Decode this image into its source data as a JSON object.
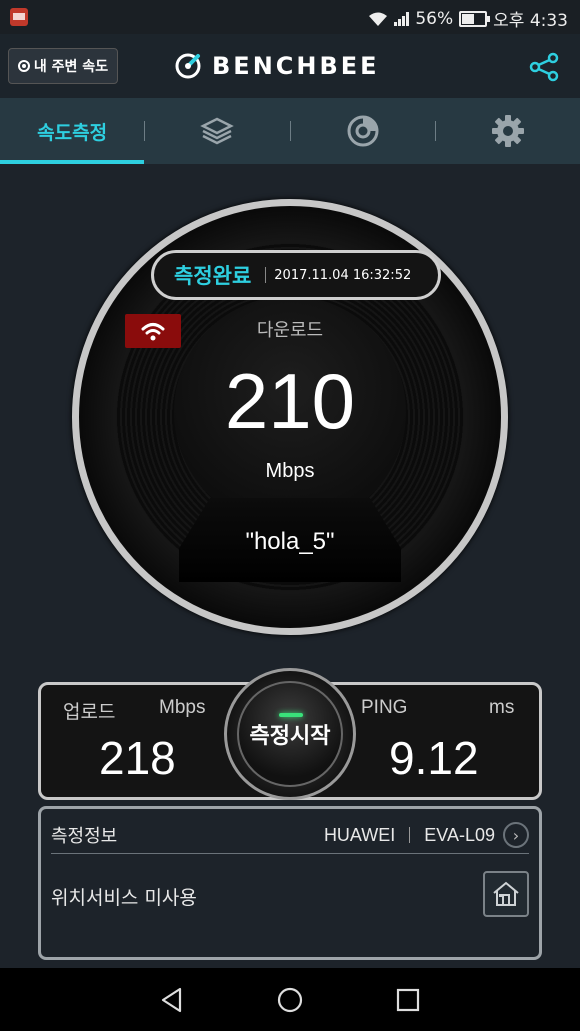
{
  "status_bar": {
    "battery": "56%",
    "time": "오후 4:33"
  },
  "header": {
    "near_button_label": "내 주변 속도",
    "logo_text": "BENCHBEE"
  },
  "tabs": [
    {
      "label": "속도측정",
      "icon": ""
    },
    {
      "label": "",
      "icon": "layers-icon"
    },
    {
      "label": "",
      "icon": "history-disc-icon"
    },
    {
      "label": "",
      "icon": "gear-icon"
    }
  ],
  "gauge": {
    "status": "측정완료",
    "datetime": "2017.11.04 16:32:52",
    "download_label": "다운로드",
    "download_value": "210",
    "download_unit": "Mbps",
    "ssid": "\"hola_5\""
  },
  "results": {
    "upload_label": "업로드",
    "upload_unit": "Mbps",
    "upload_value": "218",
    "start_label": "측정시작",
    "ping_label": "PING",
    "ping_unit": "ms",
    "ping_value": "9.12"
  },
  "info": {
    "title": "측정정보",
    "maker": "HUAWEI",
    "model": "EVA-L09",
    "location": "위치서비스 미사용"
  },
  "colors": {
    "accent": "#2ecfe0",
    "wifi_badge": "#8a0c0c",
    "led": "#39e27a"
  }
}
